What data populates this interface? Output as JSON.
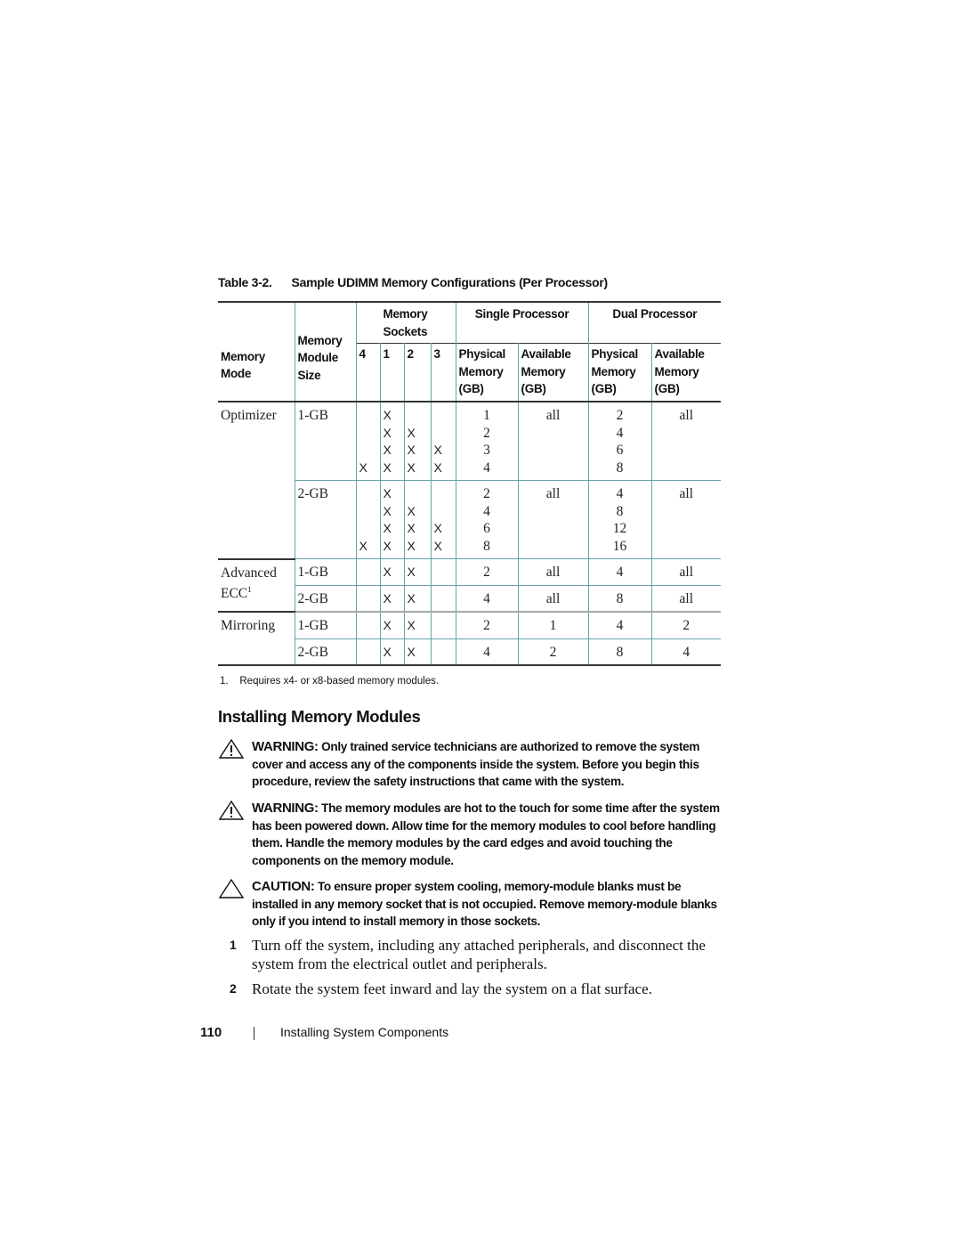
{
  "table": {
    "number": "Table 3-2.",
    "title": "Sample UDIMM Memory Configurations (Per Processor)",
    "headers": {
      "memory_mode": "Memory Mode",
      "module_size": "Memory Module Size",
      "sockets": "Memory Sockets",
      "single": "Single Processor",
      "dual": "Dual Processor",
      "socket_numbers": [
        "4",
        "1",
        "2",
        "3"
      ],
      "physical": "Physical Memory (GB)",
      "available": "Available Memory (GB)"
    },
    "groups": [
      {
        "mode": "Optimizer",
        "mode_sup": "",
        "sizes": [
          {
            "size": "1-GB",
            "lines": [
              [
                "",
                "X",
                "",
                "",
                "1",
                "all",
                "2",
                "all"
              ],
              [
                "",
                "X",
                "X",
                "",
                "2",
                "",
                "4",
                ""
              ],
              [
                "",
                "X",
                "X",
                "X",
                "3",
                "",
                "6",
                ""
              ],
              [
                "X",
                "X",
                "X",
                "X",
                "4",
                "",
                "8",
                ""
              ]
            ]
          },
          {
            "size": "2-GB",
            "lines": [
              [
                "",
                "X",
                "",
                "",
                "2",
                "all",
                "4",
                "all"
              ],
              [
                "",
                "X",
                "X",
                "",
                "4",
                "",
                "8",
                ""
              ],
              [
                "",
                "X",
                "X",
                "X",
                "6",
                "",
                "12",
                ""
              ],
              [
                "X",
                "X",
                "X",
                "X",
                "8",
                "",
                "16",
                ""
              ]
            ]
          }
        ]
      },
      {
        "mode": "Advanced ECC",
        "mode_sup": "1",
        "sizes": [
          {
            "size": "1-GB",
            "lines": [
              [
                "",
                "X",
                "X",
                "",
                "2",
                "all",
                "4",
                "all"
              ]
            ]
          },
          {
            "size": "2-GB",
            "lines": [
              [
                "",
                "X",
                "X",
                "",
                "4",
                "all",
                "8",
                "all"
              ]
            ]
          }
        ]
      },
      {
        "mode": "Mirroring",
        "mode_sup": "",
        "sizes": [
          {
            "size": "1-GB",
            "lines": [
              [
                "",
                "X",
                "X",
                "",
                "2",
                "1",
                "4",
                "2"
              ]
            ]
          },
          {
            "size": "2-GB",
            "lines": [
              [
                "",
                "X",
                "X",
                "",
                "4",
                "2",
                "8",
                "4"
              ]
            ]
          }
        ]
      }
    ],
    "footnote": "1.    Requires x4- or x8-based memory modules."
  },
  "heading": "Installing Memory Modules",
  "notices": [
    {
      "type": "warning",
      "icon": "warning-triangle-icon",
      "label": "WARNING:",
      "text": "Only trained service technicians are authorized to remove the system cover and access any of the components inside the system. Before you begin this procedure, review the safety instructions that came with the system."
    },
    {
      "type": "warning",
      "icon": "warning-triangle-icon",
      "label": "WARNING:",
      "text": "The memory modules are hot to the touch for some time after the system has been powered down. Allow time for the memory modules to cool before handling them. Handle the memory modules by the card edges and avoid touching the components on the memory module."
    },
    {
      "type": "caution",
      "icon": "caution-triangle-icon",
      "label": "CAUTION:",
      "text": "To ensure proper system cooling, memory-module blanks must be installed in any memory socket that is not occupied. Remove memory-module blanks only if you intend to install memory in those sockets."
    }
  ],
  "steps": [
    {
      "num": "1",
      "text": "Turn off the system, including any attached peripherals, and disconnect the system from the electrical outlet and peripherals."
    },
    {
      "num": "2",
      "text": "Rotate the system feet inward and lay the system on a flat surface."
    }
  ],
  "footer": {
    "page_number": "110",
    "section": "Installing System Components"
  }
}
